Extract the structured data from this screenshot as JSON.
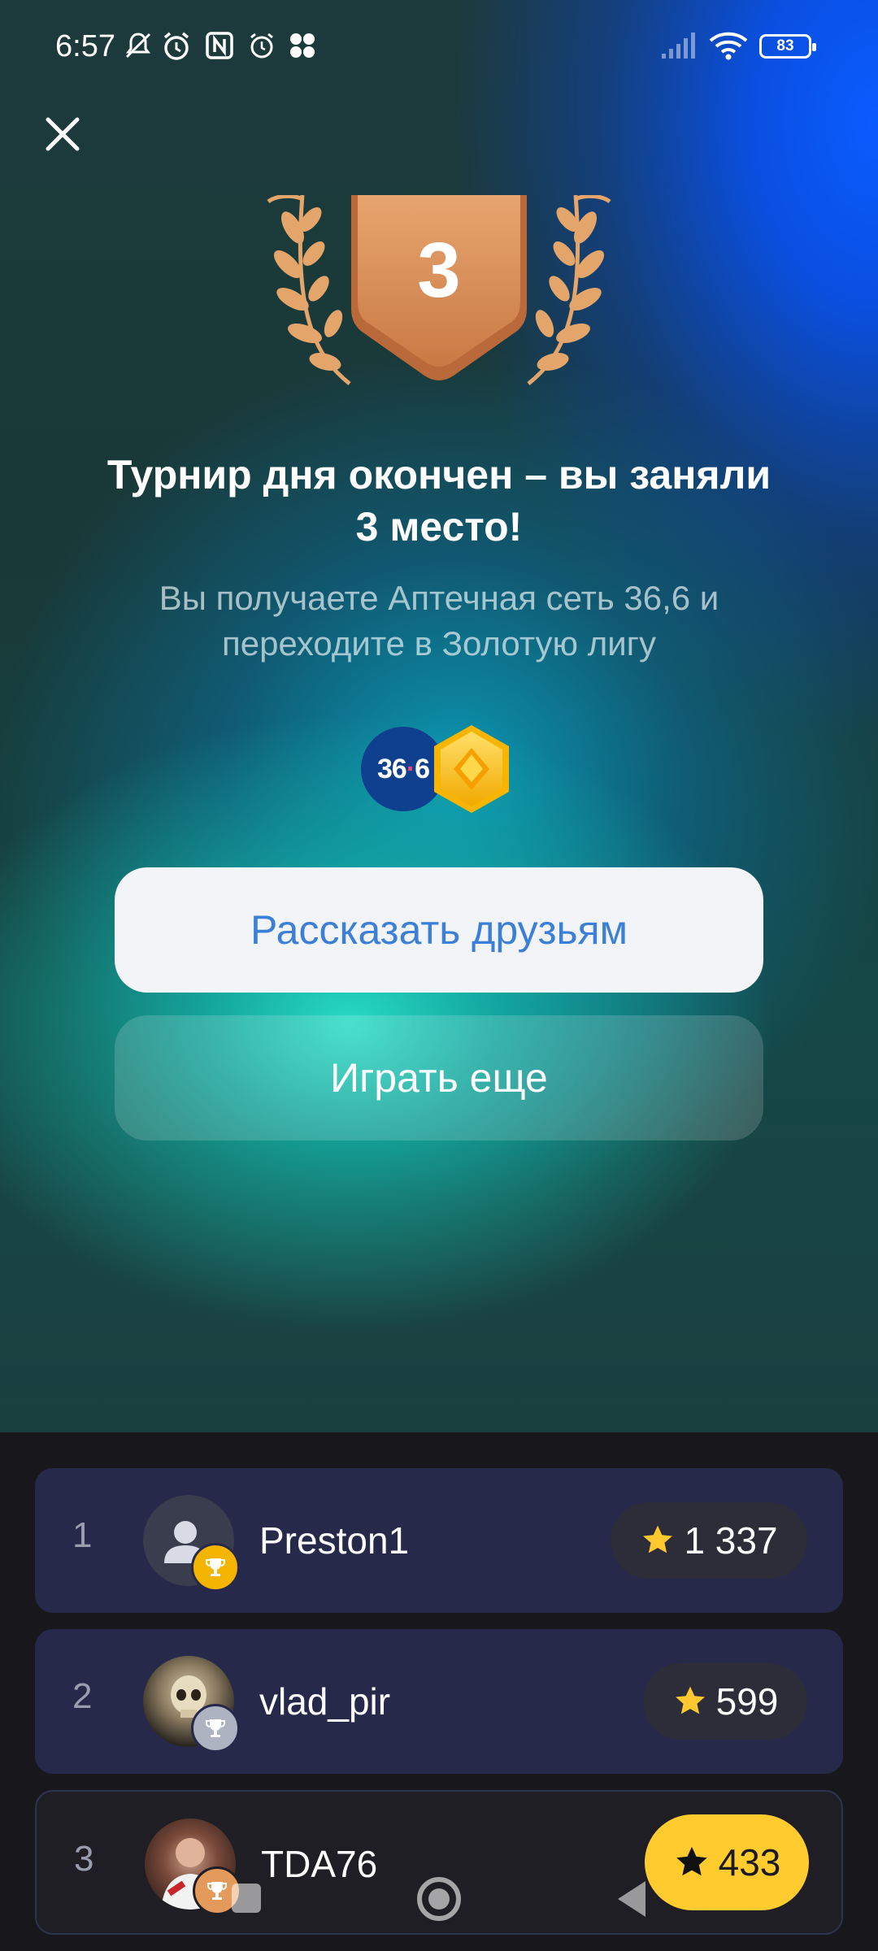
{
  "status_bar": {
    "time": "6:57",
    "battery": "83"
  },
  "trophy": {
    "place": "3"
  },
  "title": "Турнир дня окончен – вы заняли 3 место!",
  "subtitle": "Вы получаете Аптечная сеть 36,6 и переходите в Золотую лигу",
  "reward": {
    "logo_text_a": "36",
    "logo_text_b": "6"
  },
  "buttons": {
    "share": "Рассказать друзьям",
    "play_again": "Играть еще"
  },
  "leaderboard": [
    {
      "rank": "1",
      "name": "Preston1",
      "score": "1 337",
      "badge": "gold"
    },
    {
      "rank": "2",
      "name": "vlad_pir",
      "score": "599",
      "badge": "silver"
    },
    {
      "rank": "3",
      "name": "TDA76",
      "score": "433",
      "badge": "bronze"
    }
  ],
  "colors": {
    "accent_blue": "#3b7fd6",
    "gold": "#ffcb2e",
    "bronze": "#e39a5a"
  }
}
